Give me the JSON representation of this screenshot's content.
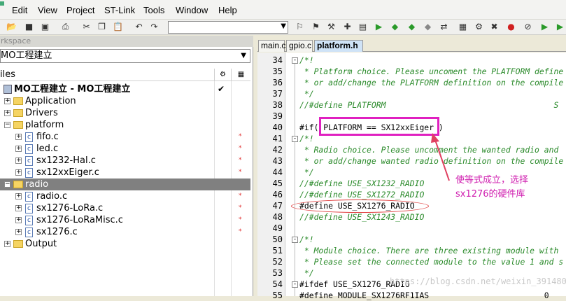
{
  "menu": [
    "Edit",
    "View",
    "Project",
    "ST-Link",
    "Tools",
    "Window",
    "Help"
  ],
  "toolbar_icons": [
    "open-folder-icon",
    "save-icon",
    "save-all-icon",
    "print-icon",
    "cut-icon",
    "copy-icon",
    "paste-icon",
    "undo-icon",
    "redo-icon"
  ],
  "workspace": {
    "title": "rkspace",
    "target": "MO工程建立",
    "files_header": "iles",
    "tree": [
      {
        "label": "MO工程建立 - MO工程建立",
        "kind": "project",
        "depth": 0,
        "check": "✔"
      },
      {
        "label": "Application",
        "kind": "folder",
        "depth": 1
      },
      {
        "label": "Drivers",
        "kind": "folder",
        "depth": 1
      },
      {
        "label": "platform",
        "kind": "folder",
        "depth": 1,
        "open": true
      },
      {
        "label": "fifo.c",
        "kind": "file",
        "depth": 2,
        "star": "*"
      },
      {
        "label": "led.c",
        "kind": "file",
        "depth": 2,
        "star": "*"
      },
      {
        "label": "sx1232-Hal.c",
        "kind": "file",
        "depth": 2,
        "star": "*"
      },
      {
        "label": "sx12xxEiger.c",
        "kind": "file",
        "depth": 2,
        "star": "*"
      },
      {
        "label": "radio",
        "kind": "folder",
        "depth": 1,
        "open": true,
        "selected": true
      },
      {
        "label": "radio.c",
        "kind": "file",
        "depth": 2,
        "star": "*"
      },
      {
        "label": "sx1276-LoRa.c",
        "kind": "file",
        "depth": 2,
        "star": "*"
      },
      {
        "label": "sx1276-LoRaMisc.c",
        "kind": "file",
        "depth": 2,
        "star": "*"
      },
      {
        "label": "sx1276.c",
        "kind": "file",
        "depth": 2,
        "star": "*"
      },
      {
        "label": "Output",
        "kind": "folder",
        "depth": 1
      }
    ]
  },
  "tabs": [
    {
      "label": "main.c",
      "active": false
    },
    {
      "label": "gpio.c",
      "active": false
    },
    {
      "label": "platform.h",
      "active": true
    }
  ],
  "code": [
    {
      "n": "34",
      "t": "/*!",
      "c": true,
      "fold": "-"
    },
    {
      "n": "35",
      "t": " * Platform choice. Please uncoment the PLATFORM define",
      "c": true
    },
    {
      "n": "36",
      "t": " * or add/change the PLATFORM definition on the compile",
      "c": true
    },
    {
      "n": "37",
      "t": " */",
      "c": true
    },
    {
      "n": "38",
      "t": "//#define PLATFORM                                   S",
      "c": true
    },
    {
      "n": "39",
      "t": "",
      "c": false
    },
    {
      "n": "40",
      "t": "#if( PLATFORM == SX12xxEiger )",
      "c": false
    },
    {
      "n": "41",
      "t": "/*!",
      "c": true,
      "fold": "-"
    },
    {
      "n": "42",
      "t": " * Radio choice. Please uncomment the wanted radio and",
      "c": true
    },
    {
      "n": "43",
      "t": " * or add/change wanted radio definition on the compile",
      "c": true
    },
    {
      "n": "44",
      "t": " */",
      "c": true
    },
    {
      "n": "45",
      "t": "//#define USE_SX1232_RADIO",
      "c": true
    },
    {
      "n": "46",
      "t": "//#define USE_SX1272_RADIO",
      "c": true
    },
    {
      "n": "47",
      "t": "#define USE_SX1276_RADIO",
      "c": false
    },
    {
      "n": "48",
      "t": "//#define USE_SX1243_RADIO",
      "c": true
    },
    {
      "n": "49",
      "t": "",
      "c": false
    },
    {
      "n": "50",
      "t": "/*!",
      "c": true,
      "fold": "-"
    },
    {
      "n": "51",
      "t": " * Module choice. There are three existing module with",
      "c": true
    },
    {
      "n": "52",
      "t": " * Please set the connected module to the value 1 and s",
      "c": true
    },
    {
      "n": "53",
      "t": " */",
      "c": true
    },
    {
      "n": "54",
      "t": "#ifdef USE_SX1276_RADIO",
      "c": false,
      "fold": "-"
    },
    {
      "n": "55",
      "t": "#define MODULE_SX1276RF1IAS                        0",
      "c": false
    }
  ],
  "annotation": {
    "line1": "使等式成立，选择",
    "line2": "sx1276的硬件库"
  },
  "watermark": "https://blog.csdn.net/weixin_39148042",
  "colors": {
    "highlight_box": "#e020c0",
    "ellipse": "#e04040",
    "arrow": "#e04060",
    "comment": "#2a8a2a"
  }
}
